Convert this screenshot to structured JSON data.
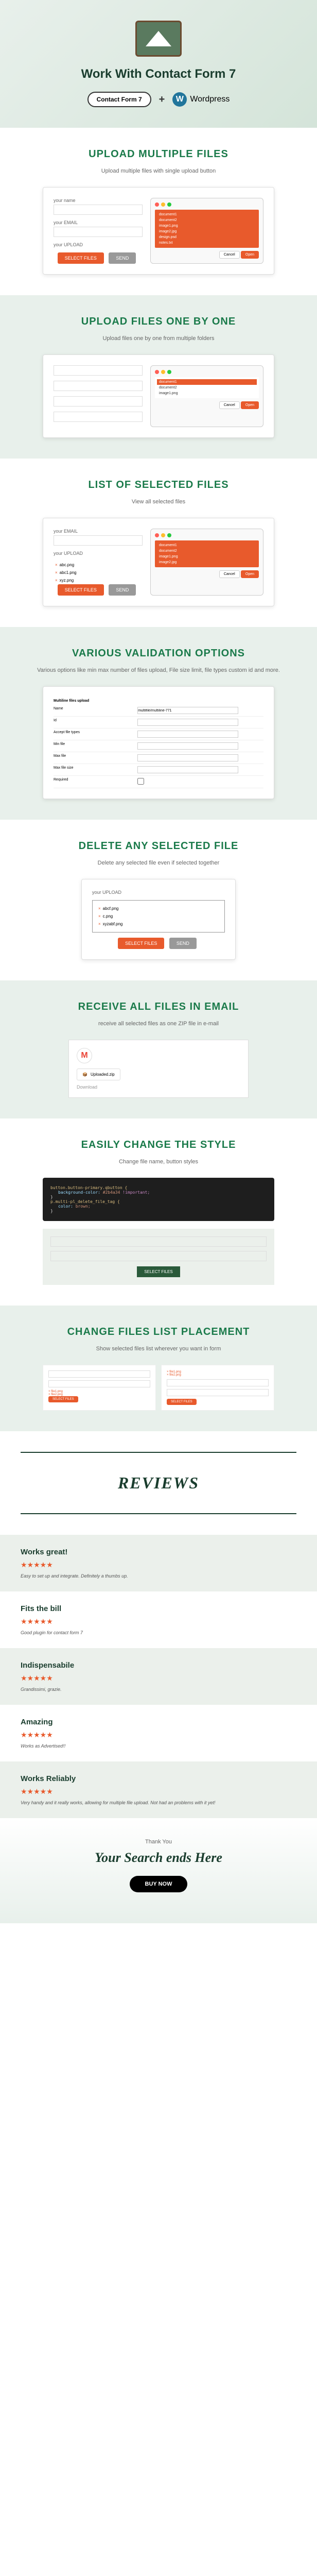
{
  "header": {
    "title": "Work With Contact Form 7",
    "badge_cf7": "Contact Form 7",
    "plus": "+",
    "badge_wp": "Wordpress"
  },
  "sections": {
    "upload_multiple": {
      "title": "UPLOAD MULTIPLE FILES",
      "desc": "Upload multiple files with single upload button"
    },
    "upload_one": {
      "title": "UPLOAD FILES ONE BY ONE",
      "desc": "Upload files one by one from multiple folders"
    },
    "list_files": {
      "title": "LIST OF SELECTED FILES",
      "desc": "View all selected files"
    },
    "validation": {
      "title": "VARIOUS VALIDATION OPTIONS",
      "desc": "Various options like min max number of files upload, File size limit, file types custom id and more."
    },
    "delete": {
      "title": "DELETE ANY SELECTED FILE",
      "desc": "Delete any selected file even if selected together"
    },
    "email": {
      "title": "RECEIVE ALL FILES IN EMAIL",
      "desc": "receive all selected files as one ZIP file in e-mail"
    },
    "style": {
      "title": "EASILY CHANGE THE STYLE",
      "desc": "Change file name, button styles"
    },
    "placement": {
      "title": "CHANGE FILES LIST PLACEMENT",
      "desc": "Show selected files list wherever you want in form"
    }
  },
  "demo": {
    "label_name": "your name",
    "label_email": "your EMAIL",
    "label_upload": "your UPLOAD",
    "btn_select": "SELECT FILES",
    "btn_send": "SEND",
    "files": [
      "document1",
      "document2",
      "image1.png",
      "image2.jpg",
      "design.psd",
      "notes.txt"
    ],
    "selected": [
      {
        "x": "×",
        "name": "abc.png"
      },
      {
        "x": "×",
        "name": "abc1.png"
      },
      {
        "x": "×",
        "name": "xyz.png"
      }
    ],
    "delete_files": [
      {
        "x": "×",
        "name": "abcf.png"
      },
      {
        "x": "×",
        "name": "c.png"
      },
      {
        "x": "×",
        "name": "xyzabf.png"
      }
    ],
    "dialog_cancel": "Cancel",
    "dialog_open": "Open"
  },
  "validation_opts": {
    "header": "Multiline files upload",
    "rows": [
      {
        "label": "Name",
        "val": "multifile/multiline-771"
      },
      {
        "label": "Id",
        "val": ""
      },
      {
        "label": "Accept file types",
        "val": ""
      },
      {
        "label": "Min file",
        "val": ""
      },
      {
        "label": "Max file",
        "val": ""
      },
      {
        "label": "Max file size",
        "val": ""
      },
      {
        "label": "Required",
        "val": ""
      }
    ]
  },
  "email_demo": {
    "attachment": "Uploaded.zip",
    "download": "Download"
  },
  "code": {
    "selector": "button.button-primary.qbutton {",
    "line1_prop": "background-color:",
    "line1_val": "#2b4a34",
    "line1_imp": "!important;",
    "line2": "}",
    "selector2": "p.multi-pl_delete_file_tag {",
    "line3_prop": "color:",
    "line3_val": "brown;",
    "line4": "}"
  },
  "reviews_title": "REVIEWS",
  "reviews": [
    {
      "title": "Works great!",
      "stars": "★★★★★",
      "text": "Easy to set up and integrate. Definitely a thumbs up."
    },
    {
      "title": "Fits the bill",
      "stars": "★★★★★",
      "text": "Good plugin for contact form 7"
    },
    {
      "title": "Indispensabile",
      "stars": "★★★★★",
      "text": "Grandissimi, grazie."
    },
    {
      "title": "Amazing",
      "stars": "★★★★★",
      "text": "Works as Advertised!!"
    },
    {
      "title": "Works Reliably",
      "stars": "★★★★★",
      "text": "Very handy and it really works, allowing for multiple file upload. Not had an problems with it yet!"
    }
  ],
  "footer": {
    "thanks": "Thank You",
    "tagline": "Your Search ends Here",
    "buy": "BUY NOW"
  }
}
